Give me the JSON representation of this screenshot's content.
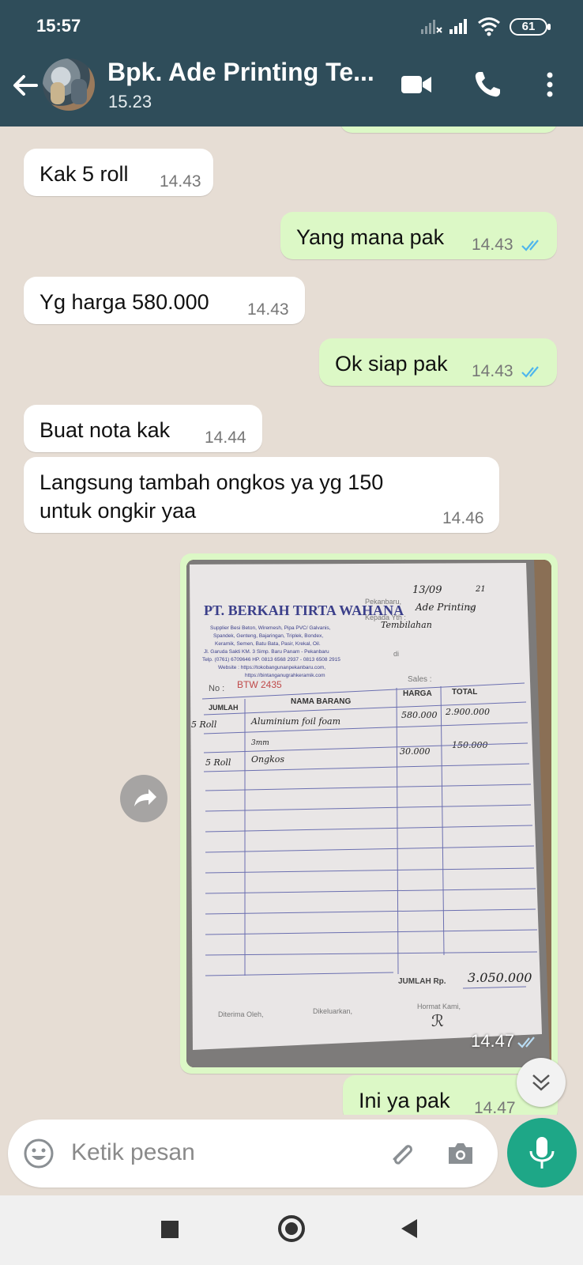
{
  "status_bar": {
    "time": "15:57",
    "battery": "61"
  },
  "header": {
    "contact_name": "Bpk. Ade Printing Te...",
    "last_seen": "15.23"
  },
  "messages": [
    {
      "dir": "in",
      "text": "Kak 5 roll",
      "time": "14.43"
    },
    {
      "dir": "out",
      "text": "Yang mana pak",
      "time": "14.43",
      "status": "read"
    },
    {
      "dir": "in",
      "text": "Yg harga 580.000",
      "time": "14.43"
    },
    {
      "dir": "out",
      "text": "Ok siap pak",
      "time": "14.43",
      "status": "read"
    },
    {
      "dir": "in",
      "text": "Buat nota kak",
      "time": "14.44"
    },
    {
      "dir": "in",
      "text": "Langsung tambah ongkos ya yg  150\nuntuk ongkir yaa",
      "time": "14.46"
    },
    {
      "dir": "out",
      "type": "image",
      "time": "14.47",
      "status": "sent"
    },
    {
      "dir": "out",
      "text": "Ini ya pak",
      "time": "14.47",
      "status": "read"
    }
  ],
  "receipt": {
    "company": "PT. BERKAH TIRTA WAHANA",
    "supplier_lines": [
      "Supplier Besi Beton, Wiremesh, Pipa PVC/ Galvanis,",
      "Spandek, Genteng, Bajaringan, Triplek, Bondex,",
      "Keramik, Semen, Batu Bata, Pasir, Krekal, Oil.",
      "Jl. Garuda Sakti KM. 3 Simp. Baru Panam - Pekanbaru",
      "Telp. (0761) 6709646 HP. 0813 6568 2937 - 0813 6508 2915",
      "Website : https://tokobangunanpekanbaru.com,",
      "https://bintanganugrahkeramik.com"
    ],
    "place_label": "Pekanbaru,",
    "date": "13/09",
    "year_prefix": "20",
    "year_suffix": "21",
    "to_label": "Kepada Yth :",
    "to_value": "Ade Printing",
    "to_value2": "Tembilahan",
    "at_label": "di",
    "no_label": "No :",
    "no_value": "BTW 2435",
    "sales_label": "Sales :",
    "col_qty": "JUMLAH",
    "col_item": "NAMA BARANG",
    "col_price": "HARGA",
    "col_total": "TOTAL",
    "rows": [
      {
        "qty": "5 Roll",
        "item": "Aluminium foil foam",
        "price": "580.000",
        "total": "2.900.000"
      },
      {
        "qty": "",
        "item": "3mm",
        "price": "",
        "total": ""
      },
      {
        "qty": "5 Roll",
        "item": "Ongkos",
        "price": "30.000",
        "total": "150.000"
      }
    ],
    "grand_total_label": "JUMLAH Rp.",
    "grand_total": "3.050.000",
    "received_label": "Diterima Oleh,",
    "issued_label": "Dikeluarkan,",
    "regards_label": "Hormat Kami,"
  },
  "input": {
    "placeholder": "Ketik pesan"
  },
  "colors": {
    "header": "#2f4d5a",
    "outgoing": "#dcf8c6",
    "incoming": "#ffffff",
    "wallpaper": "#e6ddd4",
    "mic": "#1ea787",
    "read_tick": "#4fb6ec"
  }
}
